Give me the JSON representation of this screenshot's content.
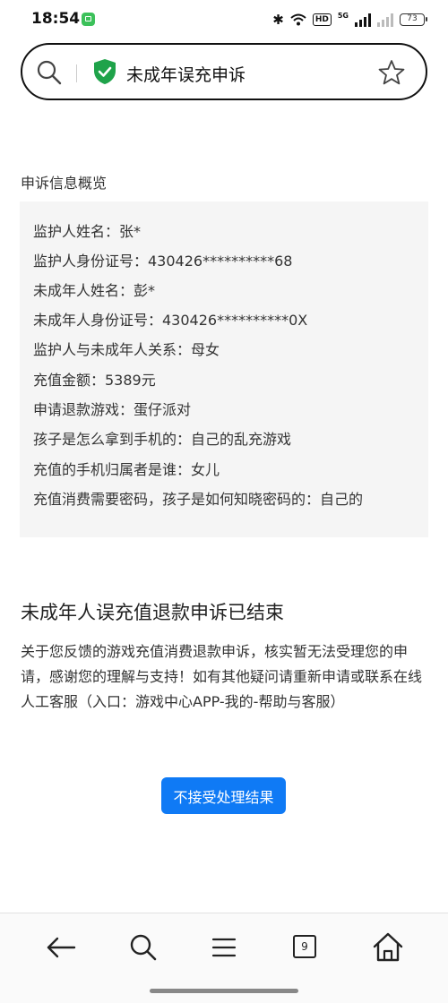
{
  "status_bar": {
    "time": "18:54",
    "network": "5G",
    "hd": "HD",
    "battery": "73"
  },
  "address_bar": {
    "title": "未成年误充申诉"
  },
  "overview": {
    "heading": "申诉信息概览",
    "rows": [
      "监护人姓名：张*",
      "监护人身份证号：430426**********68",
      "未成年人姓名：彭*",
      "未成年人身份证号：430426**********0X",
      "监护人与未成年人关系：母女",
      "充值金额：5389元",
      "申请退款游戏：蛋仔派对",
      "孩子是怎么拿到手机的：自己的乱充游戏",
      "充值的手机归属者是谁：女儿",
      "充值消费需要密码，孩子是如何知晓密码的：自己的"
    ]
  },
  "result": {
    "title": "未成年人误充值退款申诉已结束",
    "description": "关于您反馈的游戏充值消费退款申诉，核实暂无法受理您的申请，感谢您的理解与支持！如有其他疑问请重新申请或联系在线人工客服（入口：游戏中心APP-我的-帮助与客服）"
  },
  "actions": {
    "reject_label": "不接受处理结果"
  },
  "bottom_nav": {
    "tabs_count": "9",
    "items": [
      "back-icon",
      "search-icon",
      "menu-icon",
      "tabs-icon",
      "home-icon"
    ]
  },
  "colors": {
    "accent": "#0f7af5",
    "shield": "#1fa34a",
    "panel_bg": "#f5f5f5"
  }
}
